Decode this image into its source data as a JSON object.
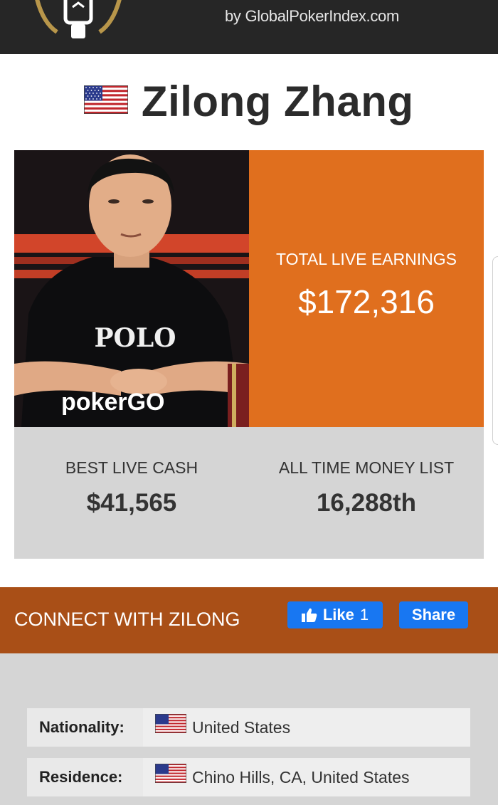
{
  "header": {
    "byline": "by GlobalPokerIndex.com",
    "logo_icon": "gpi-crest-icon"
  },
  "player": {
    "name": "Zilong Zhang",
    "flag_icon": "us-flag-icon",
    "photo": {
      "icon": "player-photo",
      "shirt_text": "POLO",
      "watermark": "pokerGO"
    }
  },
  "earnings": {
    "label": "TOTAL LIVE EARNINGS",
    "value": "$172,316"
  },
  "stats": {
    "best_cash_label": "BEST LIVE CASH",
    "best_cash_value": "$41,565",
    "money_list_label": "ALL TIME MONEY LIST",
    "money_list_value": "16,288th"
  },
  "connect": {
    "label": "CONNECT WITH ZILONG",
    "like_label": "Like",
    "like_count": "1",
    "share_label": "Share"
  },
  "info": {
    "nationality_label": "Nationality:",
    "nationality_value": "United States",
    "residence_label": "Residence:",
    "residence_value": "Chino Hills, CA, United States"
  },
  "colors": {
    "header_bg": "#262626",
    "earnings_bg": "#e06f1e",
    "connect_bg": "#a94f17",
    "panel_bg": "#d5d5d5",
    "facebook_blue": "#1877f2"
  }
}
